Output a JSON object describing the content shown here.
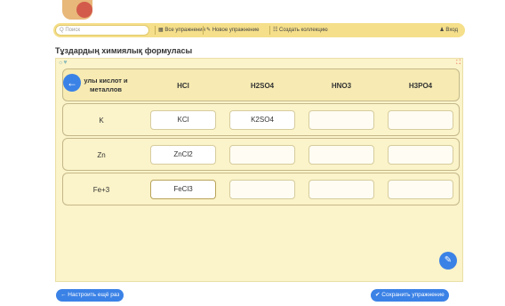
{
  "topbar": {
    "search_placeholder": "Q Поиск",
    "links": [
      "▦ Все упражнения",
      "✎ Новое упражнение",
      "☷ Создать коллекцию"
    ],
    "login": "♟ Вход"
  },
  "page_title": "Тұздардың химиялық формуласы",
  "table": {
    "corner_header": "улы кислот и металлов",
    "columns": [
      "HCl",
      "H2SO4",
      "HNO3",
      "H3PO4"
    ],
    "rows": [
      {
        "label": "K",
        "values": [
          "KCl",
          "K2SO4",
          "",
          ""
        ]
      },
      {
        "label": "Zn",
        "values": [
          "ZnCl2",
          "",
          "",
          ""
        ]
      },
      {
        "label": "Fe+3",
        "values": [
          "FeCl3",
          "",
          "",
          ""
        ]
      }
    ]
  },
  "buttons": {
    "retry": "← Настроить ещё раз",
    "save": "✔ Сохранить упражнение"
  },
  "colors": {
    "accent": "#3b82e6",
    "panel": "#fbf3c9",
    "topbar": "#f5df8a"
  }
}
